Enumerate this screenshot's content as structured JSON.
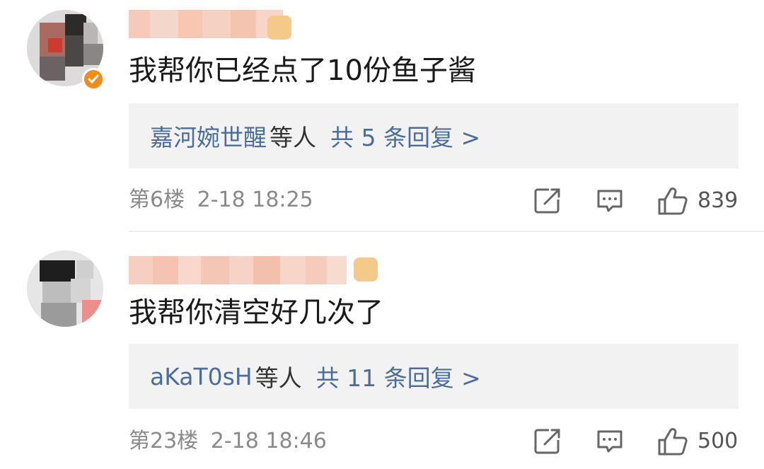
{
  "comments": [
    {
      "content": "我帮你已经点了10份鱼子酱",
      "reply_names": "嘉河婉世醒",
      "reply_suffix": "等人",
      "reply_count": "共 5 条回复 >",
      "floor": "第6楼",
      "date": "2-18 18:25",
      "likes": "839",
      "verified": true,
      "icons": [
        "avatar",
        "verified-icon",
        "share-icon",
        "comment-icon",
        "like-icon"
      ]
    },
    {
      "content": "我帮你清空好几次了",
      "reply_names": "aKaT0sH",
      "reply_suffix": "等人",
      "reply_count": "共 11 条回复 >",
      "floor": "第23楼",
      "date": "2-18 18:46",
      "likes": "500",
      "verified": false,
      "icons": [
        "avatar",
        "share-icon",
        "comment-icon",
        "like-icon"
      ]
    }
  ],
  "colors": {
    "link": "#4a6d9c",
    "meta": "#8a8a8a",
    "reply_bg": "#f2f2f2",
    "verified": "#f08b1c"
  }
}
